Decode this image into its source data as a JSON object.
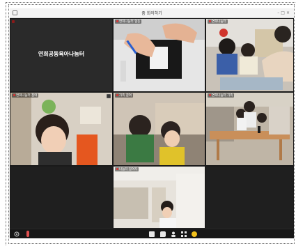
{
  "window": {
    "title": "줌 회의하기"
  },
  "tiles": [
    {
      "id": "t1",
      "label": "",
      "center_name": "연희공동육아나눔터"
    },
    {
      "id": "t2",
      "label": "연희나눔터 협동",
      "center_name": ""
    },
    {
      "id": "t3",
      "label": "연희나눔터",
      "center_name": ""
    },
    {
      "id": "t4",
      "label": "연희나눔터 참여",
      "center_name": ""
    },
    {
      "id": "t5",
      "label": "가족 참여",
      "center_name": ""
    },
    {
      "id": "t6",
      "label": "연희나눔터 가족",
      "center_name": ""
    },
    {
      "id": "t7",
      "label": "나눔터 참여자",
      "center_name": ""
    }
  ],
  "colors": {
    "background": "#1f1f1f",
    "tile": "#262626",
    "accent": "#d33333"
  },
  "toolbar": {
    "icons": [
      "settings-icon",
      "mic-icon",
      "share-screen-icon",
      "chat-icon",
      "participants-icon",
      "grid-view-icon",
      "reactions-icon"
    ]
  }
}
